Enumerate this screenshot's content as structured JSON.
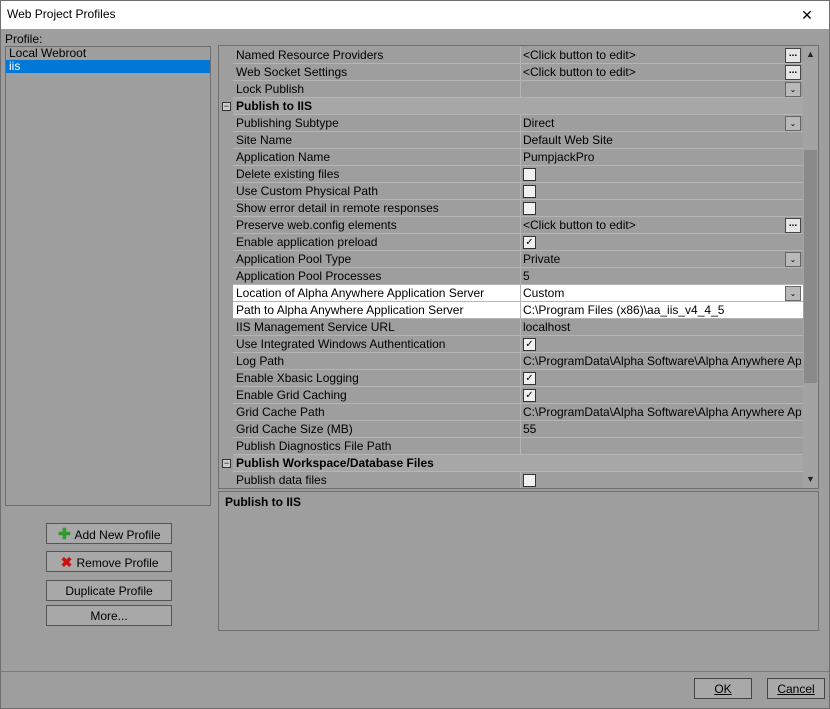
{
  "window": {
    "title": "Web Project Profiles",
    "close_glyph": "✕"
  },
  "profiles": {
    "label": "Profile:",
    "items": [
      {
        "label": "Local Webroot",
        "selected": false
      },
      {
        "label": "iis",
        "selected": true
      }
    ]
  },
  "buttons": {
    "add": "Add New Profile",
    "remove": "Remove Profile",
    "duplicate": "Duplicate Profile",
    "more": "More...",
    "ok": "OK",
    "cancel": "Cancel"
  },
  "properties": [
    {
      "type": "prop",
      "name": "Named Resource Providers",
      "value": "<Click button to edit>",
      "control": "ellipsis"
    },
    {
      "type": "prop",
      "name": "Web Socket Settings",
      "value": "<Click button to edit>",
      "control": "ellipsis"
    },
    {
      "type": "prop",
      "name": "Lock Publish",
      "value": "",
      "control": "dropdown"
    },
    {
      "type": "category",
      "name": "Publish to IIS"
    },
    {
      "type": "prop",
      "name": "Publishing Subtype",
      "value": "Direct",
      "control": "dropdown"
    },
    {
      "type": "prop",
      "name": "Site Name",
      "value": "Default Web Site"
    },
    {
      "type": "prop",
      "name": "Application Name",
      "value": "PumpjackPro"
    },
    {
      "type": "prop",
      "name": "Delete existing files",
      "value": "",
      "control": "checkbox",
      "checked": false
    },
    {
      "type": "prop",
      "name": "Use Custom Physical Path",
      "value": "",
      "control": "checkbox",
      "checked": false
    },
    {
      "type": "prop",
      "name": "Show error detail in remote responses",
      "value": "",
      "control": "checkbox",
      "checked": false
    },
    {
      "type": "prop",
      "name": "Preserve web.config elements",
      "value": "<Click button to edit>",
      "control": "ellipsis"
    },
    {
      "type": "prop",
      "name": "Enable application preload",
      "value": "",
      "control": "checkbox",
      "checked": true
    },
    {
      "type": "prop",
      "name": "Application Pool Type",
      "value": "Private",
      "control": "dropdown"
    },
    {
      "type": "prop",
      "name": "Application Pool Processes",
      "value": "5"
    },
    {
      "type": "prop",
      "name": "Location of Alpha Anywhere Application Server",
      "value": "Custom",
      "control": "dropdown",
      "highlight": true
    },
    {
      "type": "prop",
      "name": "Path to Alpha Anywhere Application Server",
      "value": "C:\\Program Files (x86)\\aa_iis_v4_4_5",
      "highlight": true
    },
    {
      "type": "prop",
      "name": "IIS Management Service URL",
      "value": "localhost"
    },
    {
      "type": "prop",
      "name": "Use Integrated Windows Authentication",
      "value": "",
      "control": "checkbox",
      "checked": true
    },
    {
      "type": "prop",
      "name": "Log Path",
      "value": "C:\\ProgramData\\Alpha Software\\Alpha Anywhere Applicat"
    },
    {
      "type": "prop",
      "name": "Enable Xbasic Logging",
      "value": "",
      "control": "checkbox",
      "checked": true
    },
    {
      "type": "prop",
      "name": "Enable Grid Caching",
      "value": "",
      "control": "checkbox",
      "checked": true
    },
    {
      "type": "prop",
      "name": "Grid Cache Path",
      "value": "C:\\ProgramData\\Alpha Software\\Alpha Anywhere Applicat"
    },
    {
      "type": "prop",
      "name": "Grid Cache Size (MB)",
      "value": "55"
    },
    {
      "type": "prop",
      "name": "Publish Diagnostics File Path",
      "value": ""
    },
    {
      "type": "category",
      "name": "Publish Workspace/Database Files"
    },
    {
      "type": "prop",
      "name": "Publish data files",
      "value": "",
      "control": "checkbox",
      "checked": false
    }
  ],
  "description": {
    "title": "Publish to IIS"
  },
  "glyphs": {
    "checkmark": "✓",
    "ellipsis": "...",
    "dropdown": "⌄",
    "collapse": "−",
    "scroll_up": "▲",
    "scroll_down": "▼",
    "plus_icon": "✚",
    "x_icon": "✖"
  }
}
